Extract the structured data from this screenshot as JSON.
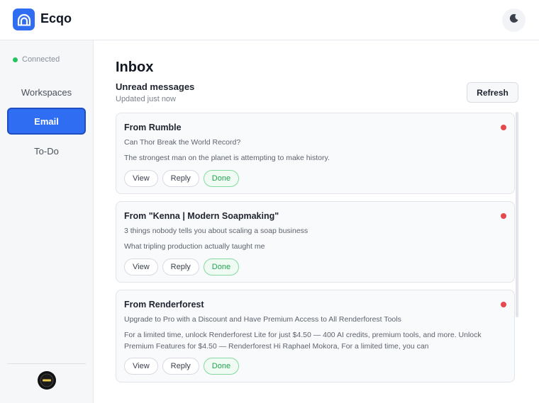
{
  "app": {
    "title": "Ecqo"
  },
  "sidebar": {
    "status": "Connected",
    "items": [
      {
        "label": "Workspaces"
      },
      {
        "label": "Email"
      },
      {
        "label": "To-Do"
      }
    ]
  },
  "main": {
    "title": "Inbox",
    "section_title": "Unread messages",
    "updated": "Updated just now",
    "refresh_label": "Refresh",
    "messages": [
      {
        "from": "From Rumble",
        "subject": "Can Thor Break the World Record?",
        "preview": "The strongest man on the planet is attempting to make history.",
        "actions": [
          "View",
          "Reply",
          "Done"
        ]
      },
      {
        "from": "From \"Kenna | Modern Soapmaking\"",
        "subject": "3 things nobody tells you about scaling a soap business",
        "preview": "What tripling production actually taught me",
        "actions": [
          "View",
          "Reply",
          "Done"
        ]
      },
      {
        "from": "From Renderforest",
        "subject": "Upgrade to Pro with a Discount and Have Premium Access to All Renderforest Tools",
        "preview": "For a limited time, unlock Renderforest Lite for just $4.50 — 400 AI credits, premium tools, and more. Unlock Premium Features for $4.50 — Renderforest Hi Raphael Mokora, For a limited time, you can",
        "actions": [
          "View",
          "Reply",
          "Done"
        ]
      }
    ]
  },
  "colors": {
    "accent": "#2f6df3",
    "status_connected": "#22c55e",
    "unread": "#e5484d",
    "done": "#22a552"
  },
  "icons": {
    "logo": "rainbow-arch-icon",
    "theme": "moon-icon",
    "avatar": "user-avatar"
  }
}
